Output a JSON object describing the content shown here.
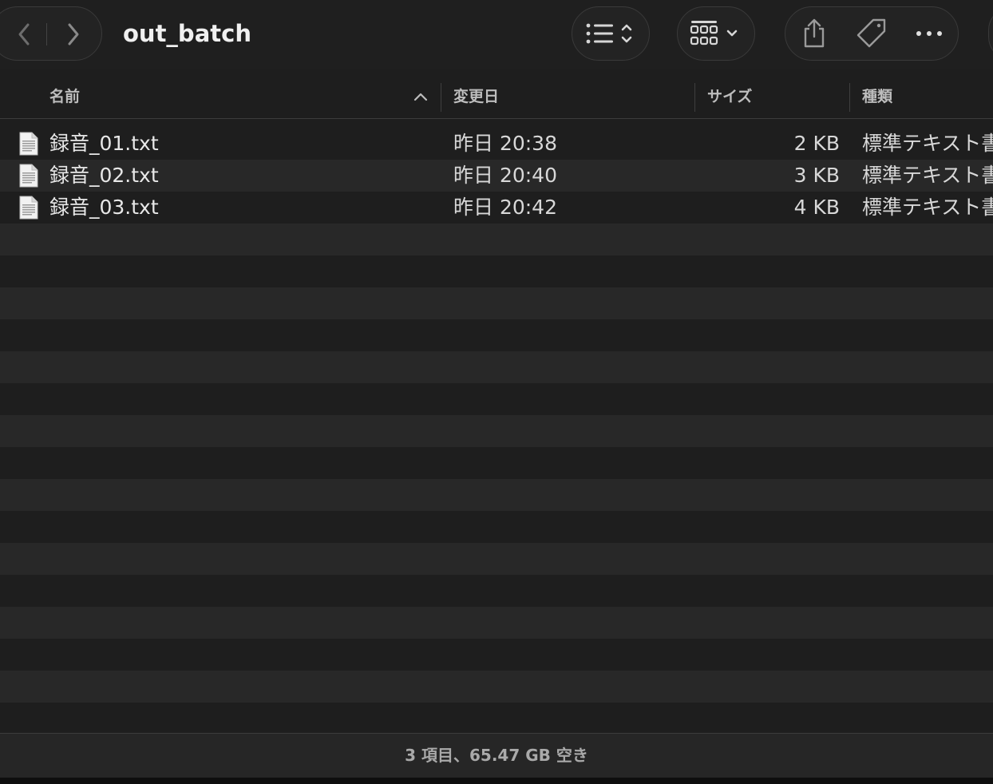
{
  "window": {
    "title": "out_batch"
  },
  "toolbar": {
    "back_icon": "chevron-left-icon",
    "forward_icon": "chevron-right-icon",
    "view_icon": "list-view-icon",
    "group_icon": "group-grid-icon",
    "share_icon": "share-icon",
    "tag_icon": "tag-icon",
    "more_icon": "ellipsis-icon"
  },
  "columns": {
    "name": "名前",
    "modified": "変更日",
    "size": "サイズ",
    "kind": "種類"
  },
  "files": [
    {
      "name": "録音_01.txt",
      "modified": "昨日 20:38",
      "size": "2 KB",
      "kind": "標準テキスト書類"
    },
    {
      "name": "録音_02.txt",
      "modified": "昨日 20:40",
      "size": "3 KB",
      "kind": "標準テキスト書類"
    },
    {
      "name": "録音_03.txt",
      "modified": "昨日 20:42",
      "size": "4 KB",
      "kind": "標準テキスト書類"
    }
  ],
  "status": {
    "text": "3 項目、65.47 GB 空き"
  },
  "colors": {
    "background": "#1e1e1e",
    "alt_row": "#282828",
    "text": "#e8e8e8"
  }
}
